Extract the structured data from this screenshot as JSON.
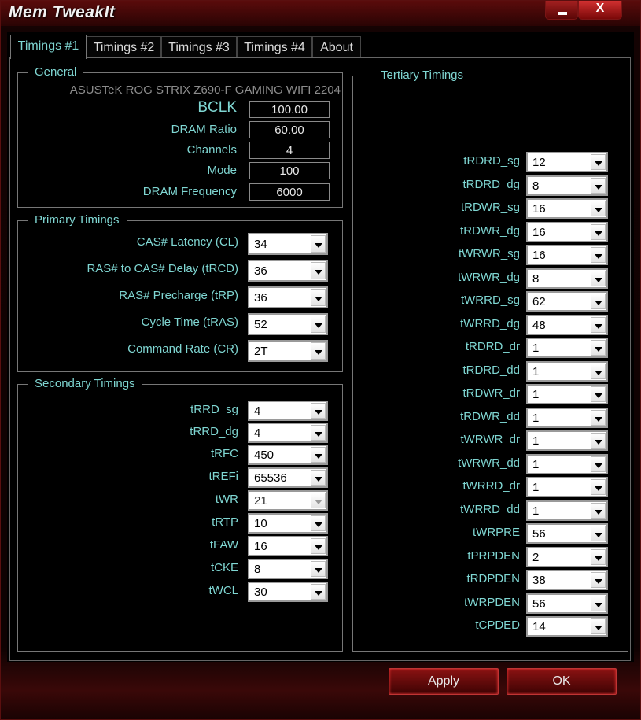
{
  "window": {
    "title": "Mem TweakIt",
    "minimize_label": "",
    "close_label": "X"
  },
  "tabs": [
    {
      "label": "Timings #1"
    },
    {
      "label": "Timings #2"
    },
    {
      "label": "Timings #3"
    },
    {
      "label": "Timings #4"
    },
    {
      "label": "About"
    }
  ],
  "general": {
    "legend": "General",
    "board": "ASUSTeK ROG STRIX Z690-F GAMING WIFI 2204",
    "fields": [
      {
        "label": "BCLK",
        "value": "100.00"
      },
      {
        "label": "DRAM Ratio",
        "value": "60.00"
      },
      {
        "label": "Channels",
        "value": "4"
      },
      {
        "label": "Mode",
        "value": "100"
      },
      {
        "label": "DRAM Frequency",
        "value": "6000"
      }
    ]
  },
  "primary": {
    "legend": "Primary Timings",
    "fields": [
      {
        "label": "CAS# Latency (CL)",
        "value": "34"
      },
      {
        "label": "RAS# to CAS# Delay (tRCD)",
        "value": "36"
      },
      {
        "label": "RAS# Precharge (tRP)",
        "value": "36"
      },
      {
        "label": "Cycle Time (tRAS)",
        "value": "52"
      },
      {
        "label": "Command Rate (CR)",
        "value": "2T"
      }
    ]
  },
  "secondary": {
    "legend": "Secondary Timings",
    "fields": [
      {
        "label": "tRRD_sg",
        "value": "4"
      },
      {
        "label": "tRRD_dg",
        "value": "4"
      },
      {
        "label": "tRFC",
        "value": "450"
      },
      {
        "label": "tREFi",
        "value": "65536"
      },
      {
        "label": "tWR",
        "value": "21",
        "disabled": true
      },
      {
        "label": "tRTP",
        "value": "10"
      },
      {
        "label": "tFAW",
        "value": "16"
      },
      {
        "label": "tCKE",
        "value": "8"
      },
      {
        "label": "tWCL",
        "value": "30"
      }
    ]
  },
  "tertiary": {
    "legend": "Tertiary Timings",
    "fields": [
      {
        "label": "tRDRD_sg",
        "value": "12"
      },
      {
        "label": "tRDRD_dg",
        "value": "8"
      },
      {
        "label": "tRDWR_sg",
        "value": "16"
      },
      {
        "label": "tRDWR_dg",
        "value": "16"
      },
      {
        "label": "tWRWR_sg",
        "value": "16"
      },
      {
        "label": "tWRWR_dg",
        "value": "8"
      },
      {
        "label": "tWRRD_sg",
        "value": "62"
      },
      {
        "label": "tWRRD_dg",
        "value": "48"
      },
      {
        "label": "tRDRD_dr",
        "value": "1"
      },
      {
        "label": "tRDRD_dd",
        "value": "1"
      },
      {
        "label": "tRDWR_dr",
        "value": "1"
      },
      {
        "label": "tRDWR_dd",
        "value": "1"
      },
      {
        "label": "tWRWR_dr",
        "value": "1"
      },
      {
        "label": "tWRWR_dd",
        "value": "1"
      },
      {
        "label": "tWRRD_dr",
        "value": "1"
      },
      {
        "label": "tWRRD_dd",
        "value": "1"
      },
      {
        "label": "tWRPRE",
        "value": "56"
      },
      {
        "label": "tPRPDEN",
        "value": "2"
      },
      {
        "label": "tRDPDEN",
        "value": "38"
      },
      {
        "label": "tWRPDEN",
        "value": "56"
      },
      {
        "label": "tCPDED",
        "value": "14"
      }
    ]
  },
  "buttons": {
    "apply": "Apply",
    "ok": "OK"
  },
  "colors": {
    "accent": "#7fd6d2",
    "frame": "#5a0b0b",
    "button": "#8a1212"
  }
}
